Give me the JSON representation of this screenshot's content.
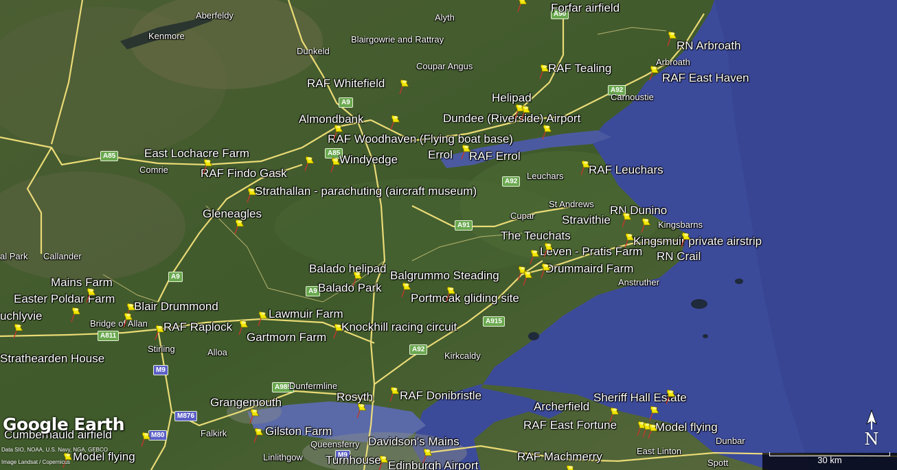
{
  "app": {
    "logo_text": "Google Earth",
    "credit_line1": "Data SIO, NOAA, U.S. Navy, NGA, GEBCO",
    "credit_line2": "Image Landsat / Copernicus",
    "scale_label": "30 km",
    "compass_label": "N"
  },
  "colors": {
    "pin": "#f2e600",
    "sea": "#3c4a9a",
    "land": "#3e5a2c",
    "road_major": "#f3e27a",
    "road_label": "#6aa84f",
    "motorway_label": "#5b5fc7"
  },
  "placemarks": [
    {
      "label": "Forfar airfield"
    },
    {
      "label": "RN Arbroath"
    },
    {
      "label": "RAF Tealing"
    },
    {
      "label": "RAF East Haven"
    },
    {
      "label": "RAF Whitefield"
    },
    {
      "label": "Helipad"
    },
    {
      "label": "Dundee (Riverside) Airport"
    },
    {
      "label": "Almondbank"
    },
    {
      "label": "RAF Woodhaven (Flying boat base)"
    },
    {
      "label": "East Lochacre Farm"
    },
    {
      "label": "Windyedge"
    },
    {
      "label": "Errol"
    },
    {
      "label": "RAF Errol"
    },
    {
      "label": "RAF Findo Gask"
    },
    {
      "label": "RAF Leuchars"
    },
    {
      "label": "Strathallan - parachuting (aircraft museum)"
    },
    {
      "label": "Gleneagles"
    },
    {
      "label": "RN Dunino"
    },
    {
      "label": "Stravithie"
    },
    {
      "label": "Kingsmuir private airstrip"
    },
    {
      "label": "The Teuchats"
    },
    {
      "label": "Leven - Pratis Farm"
    },
    {
      "label": "RN Crail"
    },
    {
      "label": "Drummaird Farm"
    },
    {
      "label": "Balado helipad"
    },
    {
      "label": "Mains Farm"
    },
    {
      "label": "Balgrummo Steading"
    },
    {
      "label": "Balado Park"
    },
    {
      "label": "Easter Poldar Farm"
    },
    {
      "label": "Portmoak gliding site"
    },
    {
      "label": "Blair Drummond"
    },
    {
      "label": "Lawmuir Farm"
    },
    {
      "label": "RAF Raplock"
    },
    {
      "label": "Knockhill racing circuit"
    },
    {
      "label": "Gartmorn Farm"
    },
    {
      "label": "Strathearden House"
    },
    {
      "label": "Grangemouth"
    },
    {
      "label": "Rosyth"
    },
    {
      "label": "RAF Donibristle"
    },
    {
      "label": "Archerfield"
    },
    {
      "label": "Sheriff Hall Estate"
    },
    {
      "label": "RAF East Fortune"
    },
    {
      "label": "Model flying"
    },
    {
      "label": "Cumbernauld airfield"
    },
    {
      "label": "Gilston Farm"
    },
    {
      "label": "Davidson's Mains"
    },
    {
      "label": "Model flying"
    },
    {
      "label": "Turnhouse"
    },
    {
      "label": "Edinburgh Airport"
    },
    {
      "label": "RAF Machmerry"
    }
  ],
  "towns": [
    {
      "label": "Aberfeldy"
    },
    {
      "label": "Alyth"
    },
    {
      "label": "Kenmore"
    },
    {
      "label": "Blairgowrie and Rattray"
    },
    {
      "label": "Dunkeld"
    },
    {
      "label": "Coupar Angus"
    },
    {
      "label": "Arbroath"
    },
    {
      "label": "Carnoustie"
    },
    {
      "label": "Comrie"
    },
    {
      "label": "Leuchars"
    },
    {
      "label": "St Andrews"
    },
    {
      "label": "Cupar"
    },
    {
      "label": "Kingsbarns"
    },
    {
      "label": "Callander"
    },
    {
      "label": "al Park"
    },
    {
      "label": "Anstruther"
    },
    {
      "label": "Bridge of Allan"
    },
    {
      "label": "uchlyvie"
    },
    {
      "label": "Stirling"
    },
    {
      "label": "Alloa"
    },
    {
      "label": "Kirkcaldy"
    },
    {
      "label": "Dunfermline"
    },
    {
      "label": "Falkirk"
    },
    {
      "label": "Queensferry"
    },
    {
      "label": "Linlithgow"
    },
    {
      "label": "Dunbar"
    },
    {
      "label": "East Linton"
    },
    {
      "label": "Spott"
    }
  ],
  "roads": [
    {
      "label": "A90"
    },
    {
      "label": "A92"
    },
    {
      "label": "A9"
    },
    {
      "label": "A85"
    },
    {
      "label": "A85"
    },
    {
      "label": "A92"
    },
    {
      "label": "A91"
    },
    {
      "label": "A9"
    },
    {
      "label": "A9"
    },
    {
      "label": "A811"
    },
    {
      "label": "A915"
    },
    {
      "label": "A92"
    },
    {
      "label": "M9"
    },
    {
      "label": "A985"
    },
    {
      "label": "M876"
    },
    {
      "label": "M80"
    },
    {
      "label": "M9"
    }
  ]
}
